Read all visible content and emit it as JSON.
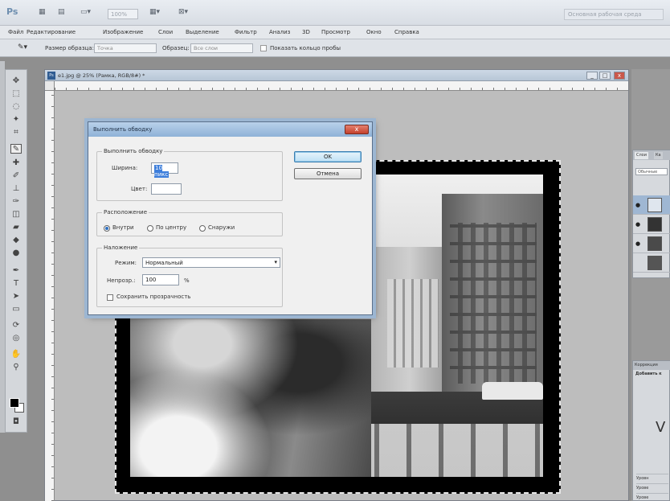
{
  "app": {
    "logo": "Ps",
    "zoom_value": "100%",
    "workspace": "Основная рабочая среда"
  },
  "menu": [
    "Файл",
    "Редактирование",
    "Изображение",
    "Слои",
    "Выделение",
    "Фильтр",
    "Анализ",
    "3D",
    "Просмотр",
    "Окно",
    "Справка"
  ],
  "options_bar": {
    "sample_size_label": "Размер образца:",
    "sample_size_value": "Точка",
    "sample_label": "Образец:",
    "sample_value": "Все слои",
    "show_ring_label": "Показать кольцо пробы"
  },
  "document": {
    "icon_label": "Ps",
    "title": "e1.jpg @ 25% (Рамка, RGB/8#) *",
    "min_label": "_",
    "max_label": "□",
    "close_label": "x"
  },
  "dialog": {
    "title": "Выполнить обводку",
    "close_label": "x",
    "stroke_group": "Выполнить обводку",
    "width_label": "Ширина:",
    "width_value": "10 пикс",
    "color_label": "Цвет:",
    "location_group": "Расположение",
    "location_options": [
      "Внутри",
      "По центру",
      "Снаружи"
    ],
    "location_selected": 0,
    "blending_group": "Наложение",
    "mode_label": "Режим:",
    "mode_value": "Нормальный",
    "opacity_label": "Непрозр.:",
    "opacity_value": "100",
    "opacity_unit": "%",
    "preserve_label": "Сохранить прозрачность",
    "ok_label": "OK",
    "cancel_label": "Отмена"
  },
  "layers_panel": {
    "tabs": [
      "Слои",
      "Ка"
    ],
    "blend_mode": "Обычные"
  },
  "adjust_panel": {
    "header": "Коррекция",
    "subtitle": "Добавить к",
    "big_letter": "V",
    "items": [
      "Уровн",
      "Урове",
      "Урове"
    ]
  },
  "colors": {
    "foreground": "#000000",
    "background": "#ffffff",
    "accent": "#3d7edb"
  }
}
